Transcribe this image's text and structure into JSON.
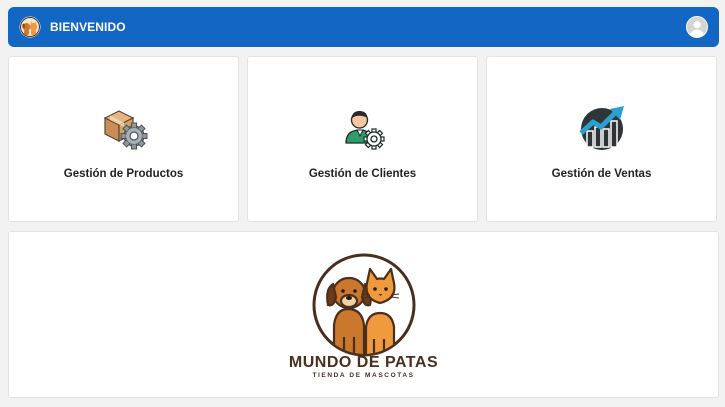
{
  "header": {
    "title": "BIENVENIDO",
    "logo_icon": "dog-cat-icon",
    "avatar_icon": "user-avatar-icon"
  },
  "cards": [
    {
      "label": "Gestión de Productos",
      "icon": "box-gear-icon"
    },
    {
      "label": "Gestión de Clientes",
      "icon": "user-gear-icon"
    },
    {
      "label": "Gestión de Ventas",
      "icon": "sales-chart-icon"
    }
  ],
  "brand": {
    "name": "MUNDO DE PATAS",
    "tagline": "TIENDA DE MASCOTAS"
  },
  "colors": {
    "header_bg": "#1266c4",
    "brand_brown": "#4a2f1f",
    "dog_orange": "#c9782e",
    "cat_orange": "#ee9a3d"
  }
}
